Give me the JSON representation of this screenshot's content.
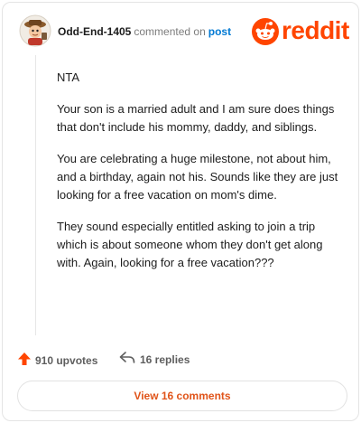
{
  "header": {
    "username": "Odd-End-1405",
    "action_text": "commented on",
    "post_link": "post",
    "brand_name": "reddit"
  },
  "comment": {
    "paragraphs": [
      "NTA",
      "Your son is a married adult and I am sure does things that don't include his mommy, daddy, and siblings.",
      "You are celebrating a huge milestone, not about him, and a birthday, again not his. Sounds like they are just looking for a free vacation on mom's dime.",
      "They sound especially entitled asking to join a trip which is about someone whom they don't get along with. Again, looking for a free vacation???"
    ]
  },
  "actions": {
    "upvotes": "910 upvotes",
    "replies": "16 replies"
  },
  "view_button": {
    "label": "View 16 comments"
  },
  "colors": {
    "brand": "#ff4500",
    "link": "#0079d3",
    "button_text": "#e0541a"
  },
  "icons": {
    "avatar": "avatar-icon",
    "brand": "reddit-snoo-icon",
    "upvote": "upvote-arrow-icon",
    "reply": "reply-arrow-icon"
  }
}
